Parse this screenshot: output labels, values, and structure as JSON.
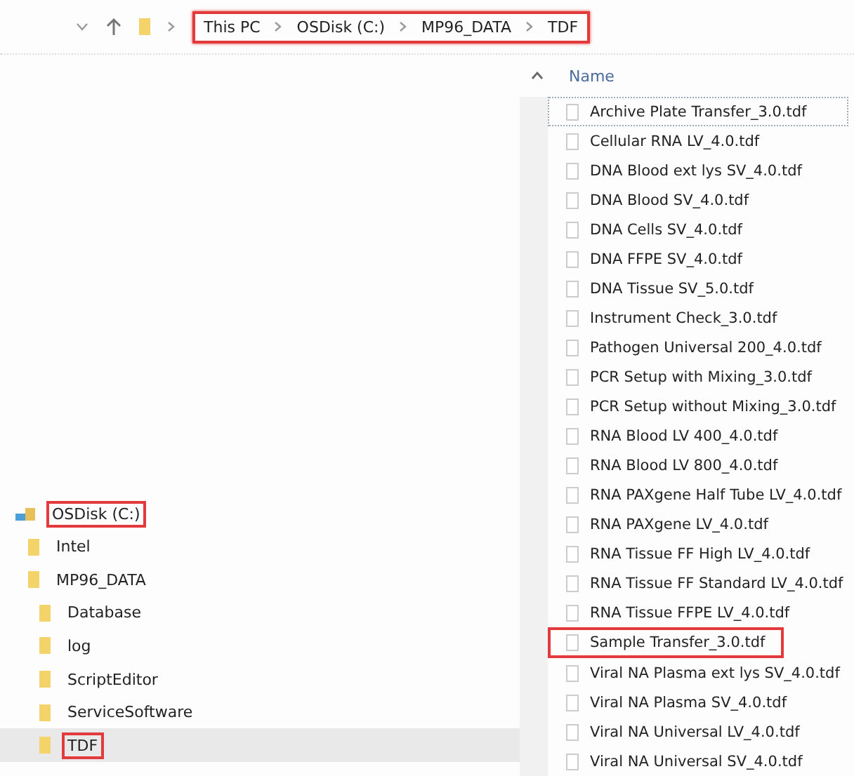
{
  "address_bar": {
    "highlighted": true,
    "path": [
      "This PC",
      "OSDisk (C:)",
      "MP96_DATA",
      "TDF"
    ]
  },
  "column_header": {
    "label": "Name"
  },
  "navigation_pane": {
    "tree": [
      {
        "label": "OSDisk (C:)",
        "kind": "drive",
        "highlighted": true,
        "selected": false,
        "children": [
          {
            "label": "Intel",
            "kind": "folder",
            "highlighted": false,
            "selected": false
          },
          {
            "label": "MP96_DATA",
            "kind": "folder",
            "highlighted": false,
            "selected": false,
            "children": [
              {
                "label": "Database",
                "kind": "folder",
                "highlighted": false,
                "selected": false
              },
              {
                "label": "log",
                "kind": "folder",
                "highlighted": false,
                "selected": false
              },
              {
                "label": "ScriptEditor",
                "kind": "folder",
                "highlighted": false,
                "selected": false
              },
              {
                "label": "ServiceSoftware",
                "kind": "folder",
                "highlighted": false,
                "selected": false
              },
              {
                "label": "TDF",
                "kind": "folder",
                "highlighted": true,
                "selected": true
              }
            ]
          }
        ]
      }
    ]
  },
  "files": [
    {
      "name": "Archive Plate Transfer_3.0.tdf",
      "focused": true,
      "highlighted": false
    },
    {
      "name": "Cellular RNA LV_4.0.tdf",
      "focused": false,
      "highlighted": false
    },
    {
      "name": "DNA Blood ext lys SV_4.0.tdf",
      "focused": false,
      "highlighted": false
    },
    {
      "name": "DNA Blood SV_4.0.tdf",
      "focused": false,
      "highlighted": false
    },
    {
      "name": "DNA Cells SV_4.0.tdf",
      "focused": false,
      "highlighted": false
    },
    {
      "name": "DNA FFPE SV_4.0.tdf",
      "focused": false,
      "highlighted": false
    },
    {
      "name": "DNA Tissue SV_5.0.tdf",
      "focused": false,
      "highlighted": false
    },
    {
      "name": "Instrument Check_3.0.tdf",
      "focused": false,
      "highlighted": false
    },
    {
      "name": "Pathogen Universal 200_4.0.tdf",
      "focused": false,
      "highlighted": false
    },
    {
      "name": "PCR Setup with Mixing_3.0.tdf",
      "focused": false,
      "highlighted": false
    },
    {
      "name": "PCR Setup without Mixing_3.0.tdf",
      "focused": false,
      "highlighted": false
    },
    {
      "name": "RNA Blood LV 400_4.0.tdf",
      "focused": false,
      "highlighted": false
    },
    {
      "name": "RNA Blood LV 800_4.0.tdf",
      "focused": false,
      "highlighted": false
    },
    {
      "name": "RNA PAXgene Half Tube LV_4.0.tdf",
      "focused": false,
      "highlighted": false
    },
    {
      "name": "RNA PAXgene LV_4.0.tdf",
      "focused": false,
      "highlighted": false
    },
    {
      "name": "RNA Tissue FF High LV_4.0.tdf",
      "focused": false,
      "highlighted": false
    },
    {
      "name": "RNA Tissue FF Standard LV_4.0.tdf",
      "focused": false,
      "highlighted": false
    },
    {
      "name": "RNA Tissue FFPE LV_4.0.tdf",
      "focused": false,
      "highlighted": false
    },
    {
      "name": "Sample Transfer_3.0.tdf",
      "focused": false,
      "highlighted": true
    },
    {
      "name": "Viral NA Plasma ext lys SV_4.0.tdf",
      "focused": false,
      "highlighted": false
    },
    {
      "name": "Viral NA Plasma SV_4.0.tdf",
      "focused": false,
      "highlighted": false
    },
    {
      "name": "Viral NA Universal LV_4.0.tdf",
      "focused": false,
      "highlighted": false
    },
    {
      "name": "Viral NA Universal SV_4.0.tdf",
      "focused": false,
      "highlighted": false
    }
  ]
}
